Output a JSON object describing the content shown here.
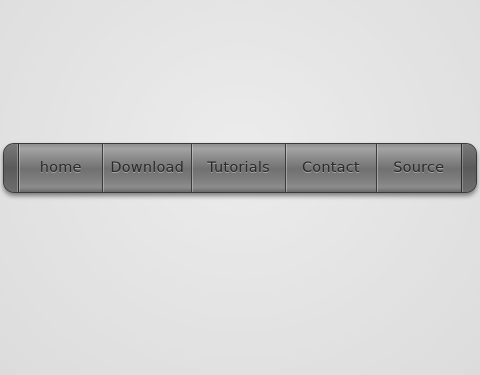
{
  "nav": {
    "items": [
      {
        "label": "home"
      },
      {
        "label": "Download"
      },
      {
        "label": "Tutorials"
      },
      {
        "label": "Contact"
      },
      {
        "label": "Source"
      }
    ]
  }
}
